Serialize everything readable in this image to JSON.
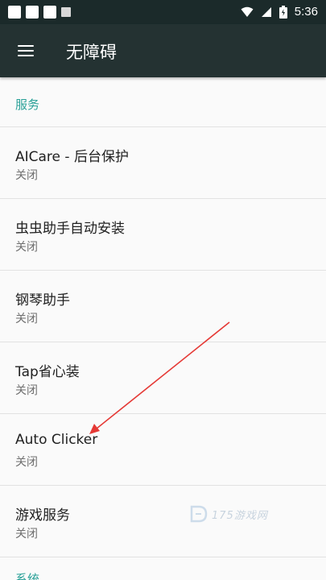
{
  "status_bar": {
    "time": "5:36",
    "icons": [
      "notification-icon",
      "notification-icon",
      "notification-icon",
      "notification-icon",
      "wifi-icon",
      "signal-icon",
      "battery-icon"
    ]
  },
  "app_bar": {
    "menu_icon": "hamburger-menu-icon",
    "title": "无障碍"
  },
  "sections": [
    {
      "header": "服务",
      "items": [
        {
          "title": "AICare - 后台保护",
          "status": "关闭"
        },
        {
          "title": "虫虫助手自动安装",
          "status": "关闭"
        },
        {
          "title": "钢琴助手",
          "status": "关闭"
        },
        {
          "title": "Tap省心装",
          "status": "关闭"
        },
        {
          "title": "Auto Clicker",
          "status": "关闭"
        },
        {
          "title": "游戏服务",
          "status": "关闭"
        }
      ]
    },
    {
      "header": "系统"
    }
  ],
  "watermark": {
    "text": "175游戏网"
  },
  "annotation": {
    "arrow_color": "#e53935",
    "target": "Auto Clicker"
  },
  "colors": {
    "status_bar": "#1b2a2a",
    "app_bar": "#243232",
    "section_header": "#2aa198",
    "background": "#fafafa"
  }
}
